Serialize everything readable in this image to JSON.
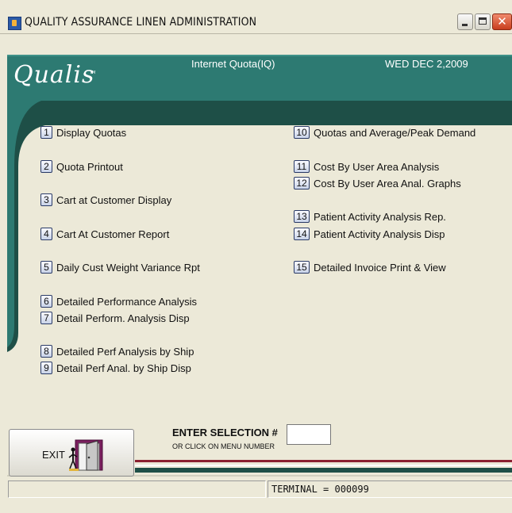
{
  "window": {
    "title": "QUALITY ASSURANCE LINEN ADMINISTRATION",
    "close_glyph": "✕"
  },
  "header": {
    "logo": "Qualis",
    "logo_tm": "TM",
    "subtitle": "Internet Quota(IQ)",
    "date": "WED DEC 2,2009"
  },
  "menu": {
    "left": [
      {
        "num": "1",
        "label": "Display Quotas"
      },
      {
        "num": "2",
        "label": "Quota Printout"
      },
      {
        "num": "3",
        "label": "Cart at Customer Display"
      },
      {
        "num": "4",
        "label": "Cart At Customer Report"
      },
      {
        "num": "5",
        "label": "Daily Cust Weight Variance Rpt"
      },
      {
        "num": "6",
        "label": "Detailed Performance Analysis"
      },
      {
        "num": "7",
        "label": "Detail Perform. Analysis Disp"
      },
      {
        "num": "8",
        "label": "Detailed Perf Analysis by Ship"
      },
      {
        "num": "9",
        "label": "Detail Perf Anal. by Ship Disp"
      }
    ],
    "right": [
      {
        "num": "10",
        "label": "Quotas and Average/Peak Demand"
      },
      {
        "num": "11",
        "label": "Cost By User Area Analysis"
      },
      {
        "num": "12",
        "label": "Cost By User Area Anal. Graphs"
      },
      {
        "num": "13",
        "label": "Patient Activity Analysis Rep."
      },
      {
        "num": "14",
        "label": "Patient Activity Analysis Disp"
      },
      {
        "num": "15",
        "label": "Detailed Invoice Print & View"
      }
    ]
  },
  "exit": {
    "label": "EXIT"
  },
  "selection": {
    "prompt": "ENTER SELECTION #",
    "hint": "OR CLICK ON MENU NUMBER",
    "value": ""
  },
  "status": {
    "left": "",
    "terminal": "TERMINAL = 000099"
  },
  "colors": {
    "teal": "#2d7a72",
    "dark_green": "#1e4f47",
    "maroon": "#8b2131"
  }
}
